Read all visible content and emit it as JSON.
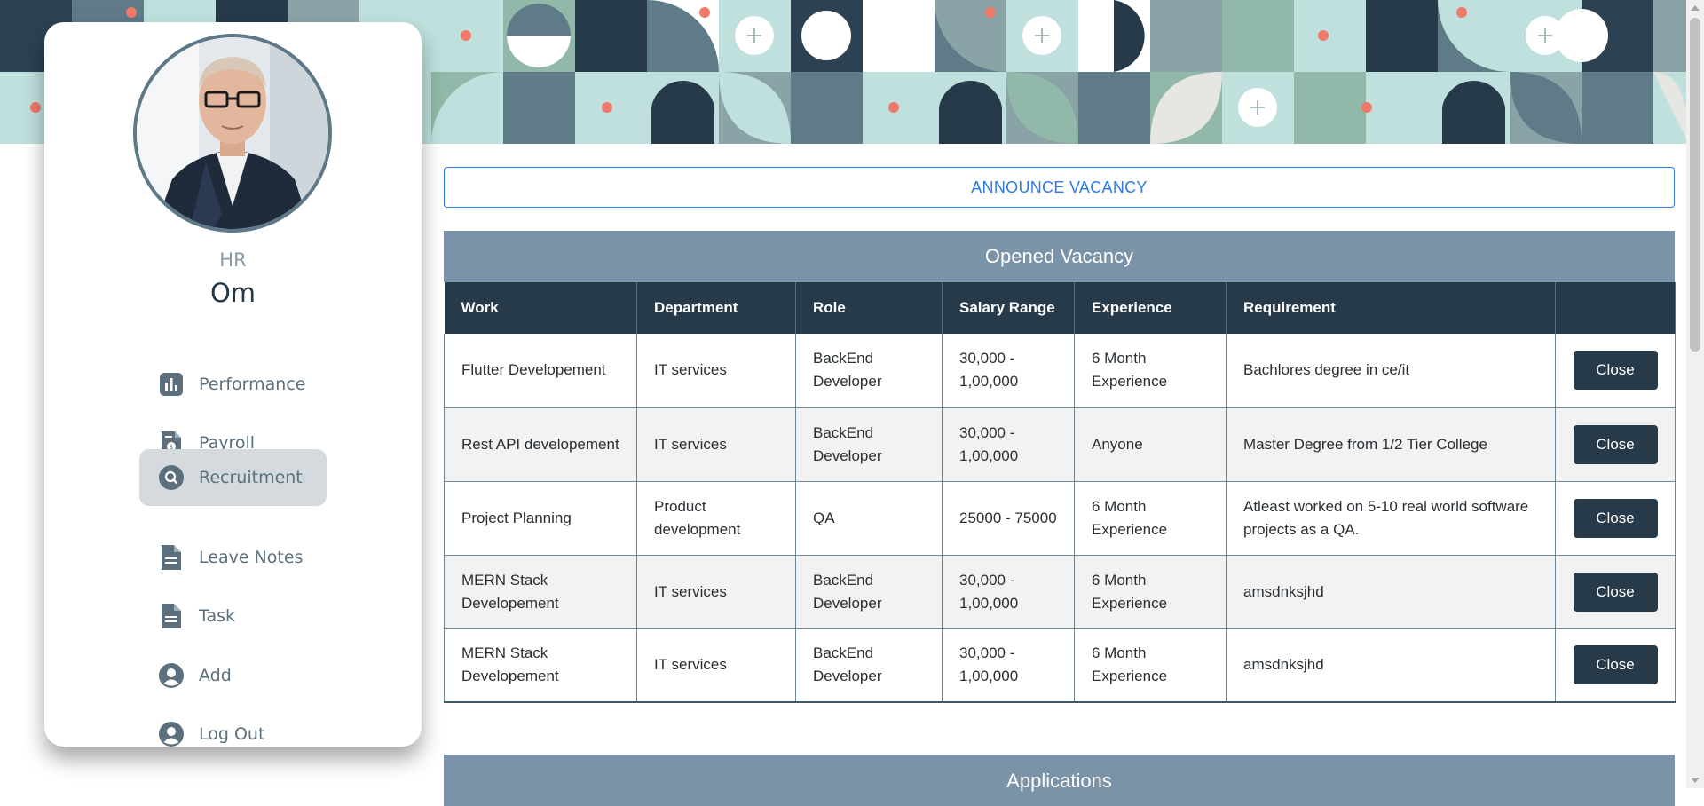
{
  "profile": {
    "role": "HR",
    "name": "Om"
  },
  "nav": {
    "items": [
      {
        "label": "Performance",
        "icon": "bar-chart-icon"
      },
      {
        "label": "Payroll",
        "icon": "invoice-icon"
      },
      {
        "label": "Recruitment",
        "icon": "search-icon",
        "active": true
      },
      {
        "label": "Leave Notes",
        "icon": "document-icon"
      },
      {
        "label": "Task",
        "icon": "document-icon"
      },
      {
        "label": "Add",
        "icon": "user-circle-icon"
      },
      {
        "label": "Log Out",
        "icon": "user-circle-icon"
      }
    ]
  },
  "actions": {
    "announce_label": "ANNOUNCE VACANCY"
  },
  "vacancy": {
    "title": "Opened Vacancy",
    "columns": [
      "Work",
      "Department",
      "Role",
      "Salary Range",
      "Experience",
      "Requirement",
      ""
    ],
    "rows": [
      {
        "work": "Flutter Developement",
        "department": "IT services",
        "role": "BackEnd Developer",
        "salary": "30,000 - 1,00,000",
        "experience": "6 Month Experience",
        "requirement": "Bachlores degree in ce/it",
        "action": "Close"
      },
      {
        "work": "Rest API developement",
        "department": "IT services",
        "role": "BackEnd Developer",
        "salary": "30,000 - 1,00,000",
        "experience": "Anyone",
        "requirement": "Master Degree from 1/2 Tier College",
        "action": "Close"
      },
      {
        "work": "Project Planning",
        "department": "Product development",
        "role": "QA",
        "salary": "25000 - 75000",
        "experience": "6 Month Experience",
        "requirement": "Atleast worked on 5-10 real world software projects as a QA.",
        "action": "Close"
      },
      {
        "work": "MERN Stack Developement",
        "department": "IT services",
        "role": "BackEnd Developer",
        "salary": "30,000 - 1,00,000",
        "experience": "6 Month Experience",
        "requirement": "amsdnksjhd",
        "action": "Close"
      },
      {
        "work": "MERN Stack Developement",
        "department": "IT services",
        "role": "BackEnd Developer",
        "salary": "30,000 - 1,00,000",
        "experience": "6 Month Experience",
        "requirement": "amsdnksjhd",
        "action": "Close"
      }
    ]
  },
  "applications": {
    "title": "Applications"
  },
  "colors": {
    "accent": "#2c7be5",
    "table_header": "#263a4a",
    "panel_header": "#7a93a8",
    "nav_text": "#5b6f7c",
    "banner_coral": "#f07a6a"
  }
}
